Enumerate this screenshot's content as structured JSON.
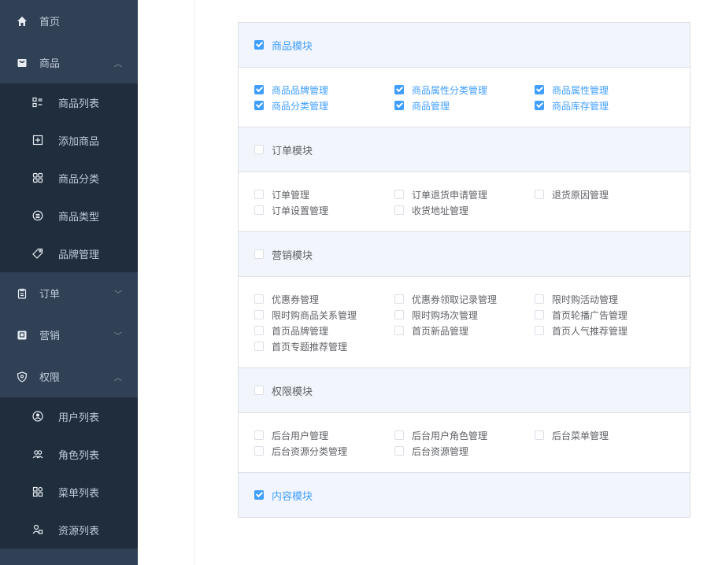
{
  "sidebar": {
    "home": "首页",
    "goods": {
      "label": "商品",
      "expanded": true,
      "items": [
        "商品列表",
        "添加商品",
        "商品分类",
        "商品类型",
        "品牌管理"
      ]
    },
    "order": {
      "label": "订单",
      "expanded": false
    },
    "marketing": {
      "label": "营销",
      "expanded": false
    },
    "permission": {
      "label": "权限",
      "expanded": true,
      "items": [
        "用户列表",
        "角色列表",
        "菜单列表",
        "资源列表"
      ]
    }
  },
  "modules": [
    {
      "name": "商品模块",
      "checked": true,
      "items": [
        {
          "label": "商品品牌管理",
          "checked": true
        },
        {
          "label": "商品属性分类管理",
          "checked": true
        },
        {
          "label": "商品属性管理",
          "checked": true
        },
        {
          "label": "商品分类管理",
          "checked": true
        },
        {
          "label": "商品管理",
          "checked": true
        },
        {
          "label": "商品库存管理",
          "checked": true
        }
      ]
    },
    {
      "name": "订单模块",
      "checked": false,
      "items": [
        {
          "label": "订单管理",
          "checked": false
        },
        {
          "label": "订单退货申请管理",
          "checked": false
        },
        {
          "label": "退货原因管理",
          "checked": false
        },
        {
          "label": "订单设置管理",
          "checked": false
        },
        {
          "label": "收货地址管理",
          "checked": false
        }
      ]
    },
    {
      "name": "营销模块",
      "checked": false,
      "items": [
        {
          "label": "优惠券管理",
          "checked": false
        },
        {
          "label": "优惠券领取记录管理",
          "checked": false
        },
        {
          "label": "限时购活动管理",
          "checked": false
        },
        {
          "label": "限时购商品关系管理",
          "checked": false
        },
        {
          "label": "限时购场次管理",
          "checked": false
        },
        {
          "label": "首页轮播广告管理",
          "checked": false
        },
        {
          "label": "首页品牌管理",
          "checked": false
        },
        {
          "label": "首页新品管理",
          "checked": false
        },
        {
          "label": "首页人气推荐管理",
          "checked": false
        },
        {
          "label": "首页专题推荐管理",
          "checked": false
        }
      ]
    },
    {
      "name": "权限模块",
      "checked": false,
      "items": [
        {
          "label": "后台用户管理",
          "checked": false
        },
        {
          "label": "后台用户角色管理",
          "checked": false
        },
        {
          "label": "后台菜单管理",
          "checked": false
        },
        {
          "label": "后台资源分类管理",
          "checked": false
        },
        {
          "label": "后台资源管理",
          "checked": false
        }
      ]
    },
    {
      "name": "内容模块",
      "checked": true,
      "items": []
    }
  ],
  "colors": {
    "sidebar_bg": "#304156",
    "submenu_bg": "#1f2d3d",
    "accent": "#409eff"
  },
  "icons": {
    "home": "home-icon",
    "goods": "shopping-bag-icon",
    "order": "clipboard-icon",
    "marketing": "coupon-icon",
    "permission": "shield-icon",
    "goods_items": [
      "list-icon",
      "plus-square-icon",
      "grid-icon",
      "list-circle-icon",
      "tag-icon"
    ],
    "perm_items": [
      "user-circle-icon",
      "users-icon",
      "menu-grid-icon",
      "resource-icon"
    ]
  }
}
